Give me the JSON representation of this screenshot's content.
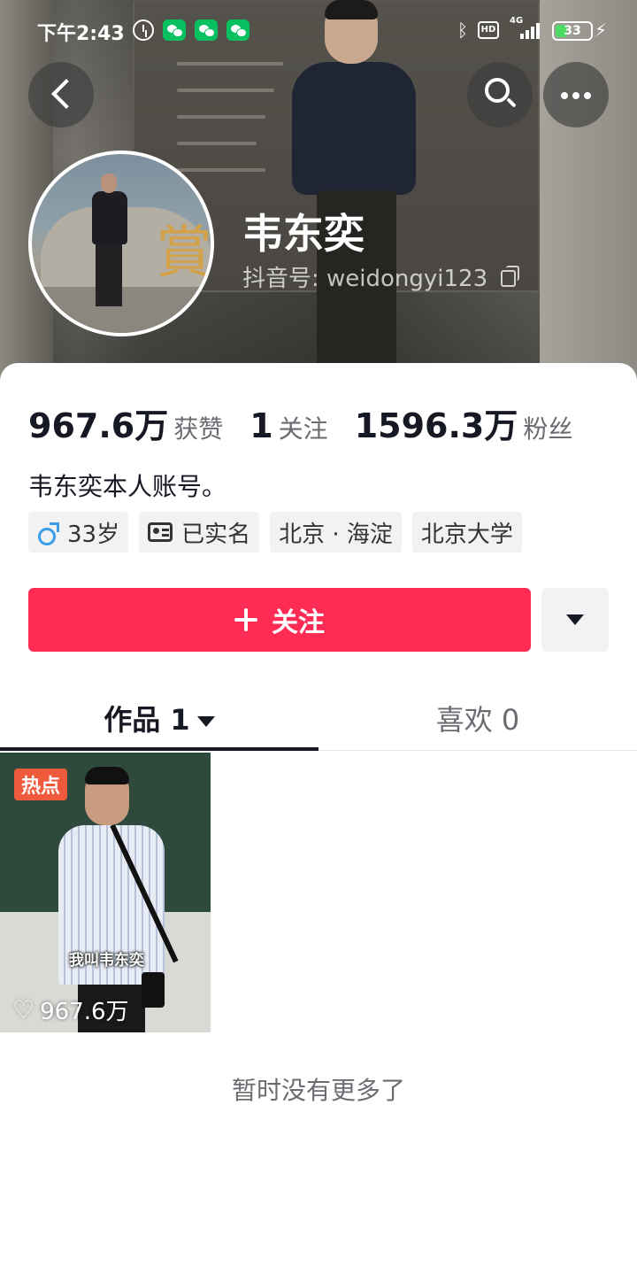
{
  "status_bar": {
    "time": "下午2:43",
    "network": "4G",
    "hd": "HD",
    "battery": "33",
    "battery_percent": 33
  },
  "header": {
    "back_icon": "chevron-left-icon",
    "search_icon": "search-icon",
    "more_icon": "more-horizontal-icon"
  },
  "profile": {
    "name": "韦东奕",
    "douyin_id": "抖音号: weidongyi123",
    "bio": "韦东奕本人账号。"
  },
  "stats": [
    {
      "value": "967.6万",
      "label": "获赞"
    },
    {
      "value": "1",
      "label": "关注"
    },
    {
      "value": "1596.3万",
      "label": "粉丝"
    }
  ],
  "tags": {
    "age": "33岁",
    "verified": "已实名",
    "location": "北京 · 海淀",
    "school": "北京大学"
  },
  "actions": {
    "follow_label": "关注"
  },
  "tabs": {
    "works": "作品 1",
    "likes": "喜欢 0"
  },
  "video": {
    "badge": "热点",
    "caption": "我叫韦东奕",
    "likes": "967.6万"
  },
  "footer": {
    "no_more": "暂时没有更多了"
  },
  "colors": {
    "accent": "#fe2c55",
    "hot_badge": "#f05a3c",
    "male": "#3a9ee8",
    "battery": "#4cd964"
  }
}
